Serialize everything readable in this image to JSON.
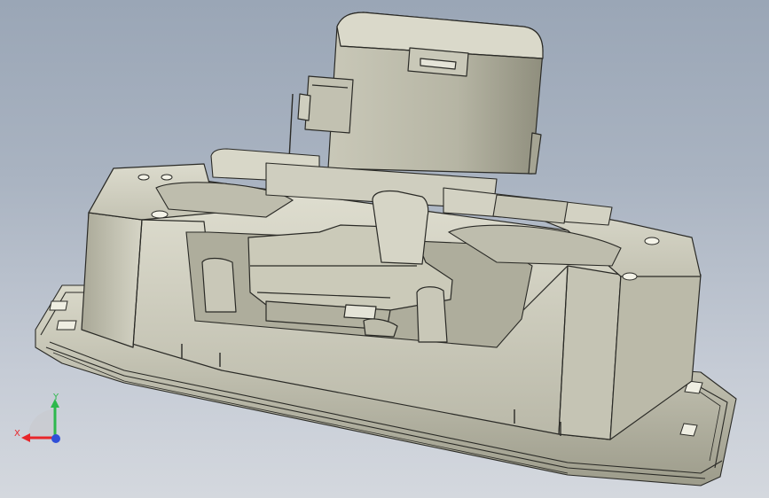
{
  "viewport": {
    "background_top": "#9aa6b6",
    "background_bottom": "#d4d8de",
    "model_color": "#d3d2c2",
    "edge_color": "#2a2a26"
  },
  "triad": {
    "x_label": "X",
    "y_label": "Y",
    "x_color": "#e8262a",
    "y_color": "#2db84d",
    "z_color": "#2f4fd8"
  }
}
